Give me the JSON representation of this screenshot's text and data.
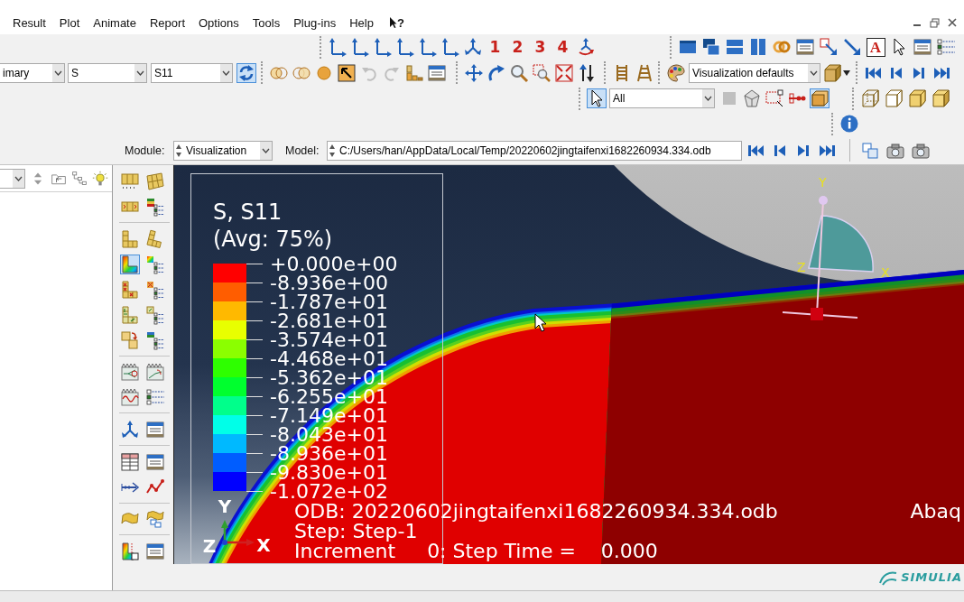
{
  "menu_bar": {
    "items": [
      "Result",
      "Plot",
      "Animate",
      "Report",
      "Options",
      "Tools",
      "Plug-ins",
      "Help"
    ],
    "context_help": "?"
  },
  "toolbar_row_1": {
    "view_tools": [
      {
        "kind": "axes",
        "pressed": false
      },
      {
        "kind": "axes",
        "pressed": false
      },
      {
        "kind": "axes",
        "pressed": false
      },
      {
        "kind": "axes",
        "pressed": false
      },
      {
        "kind": "axes",
        "pressed": false
      },
      {
        "kind": "axes",
        "pressed": false
      },
      {
        "kind": "triad",
        "pressed": false
      },
      {
        "kind": "label",
        "label": "1",
        "pressed": false
      },
      {
        "kind": "label",
        "label": "2",
        "pressed": false
      },
      {
        "kind": "label",
        "label": "3",
        "pressed": false
      },
      {
        "kind": "label",
        "label": "4",
        "pressed": false
      },
      {
        "kind": "spin",
        "pressed": false
      }
    ],
    "window_tools": [
      {
        "kind": "viewport",
        "pressed": false
      },
      {
        "kind": "cascade",
        "pressed": false
      },
      {
        "kind": "tilehor",
        "pressed": false
      },
      {
        "kind": "tilever",
        "pressed": false
      },
      {
        "kind": "link",
        "pressed": false
      },
      {
        "kind": "table",
        "pressed": false
      },
      {
        "kind": "annotate",
        "pressed": false
      },
      {
        "kind": "arrow",
        "pressed": false
      },
      {
        "kind": "boxlabel",
        "label": "A",
        "pressed": false
      },
      {
        "kind": "cursor",
        "pressed": false
      },
      {
        "kind": "table",
        "pressed": false
      },
      {
        "kind": "list",
        "pressed": false
      }
    ]
  },
  "toolbar_row_2": {
    "fields": [
      {
        "value": "imary"
      },
      {
        "value": "S"
      },
      {
        "value": "S11"
      }
    ],
    "sync_tools": [
      {
        "kind": "sync",
        "pressed": true
      }
    ],
    "plot_tools": [
      {
        "kind": "circles",
        "pressed": false,
        "disabled": false
      },
      {
        "kind": "rings",
        "pressed": false,
        "disabled": false
      },
      {
        "kind": "dot",
        "pressed": false,
        "disabled": false
      },
      {
        "kind": "probe",
        "pressed": false,
        "disabled": false
      },
      {
        "kind": "undo",
        "pressed": false,
        "disabled": true
      },
      {
        "kind": "redo",
        "pressed": false,
        "disabled": true
      },
      {
        "kind": "blocks",
        "pressed": false,
        "disabled": false
      },
      {
        "kind": "table",
        "pressed": false,
        "disabled": false
      }
    ],
    "view_tools": [
      {
        "kind": "pan",
        "pressed": false
      },
      {
        "kind": "rotate",
        "pressed": false
      },
      {
        "kind": "zoom",
        "pressed": false
      },
      {
        "kind": "boxzoom",
        "pressed": false
      },
      {
        "kind": "fit",
        "pressed": false
      },
      {
        "kind": "flip",
        "pressed": false
      }
    ],
    "ladder_tools": [
      {
        "kind": "ladder",
        "pressed": false
      },
      {
        "kind": "trapezoid",
        "pressed": false
      }
    ],
    "palette_tools": [
      {
        "kind": "palette",
        "pressed": false
      }
    ],
    "style_field": {
      "value": "Visualization defaults"
    },
    "render_tools": [
      {
        "kind": "cube",
        "pressed": false
      }
    ],
    "frame_tools": [
      {
        "kind": "first",
        "pressed": false
      },
      {
        "kind": "prev",
        "pressed": false
      },
      {
        "kind": "next",
        "pressed": false
      },
      {
        "kind": "last",
        "pressed": false
      }
    ]
  },
  "toolbar_row_3": {
    "pick_tools": [
      {
        "kind": "cursor",
        "pressed": true
      }
    ],
    "pick_field": {
      "value": "All"
    },
    "filter_tools": [
      {
        "kind": "square",
        "pressed": false,
        "disabled": true
      },
      {
        "kind": "poly",
        "pressed": false,
        "disabled": false
      },
      {
        "kind": "selectbox",
        "pressed": false,
        "disabled": false
      },
      {
        "kind": "dots",
        "pressed": false,
        "disabled": false
      },
      {
        "kind": "box",
        "pressed": true,
        "disabled": false
      }
    ],
    "style_tools": [
      {
        "kind": "wire",
        "pressed": false
      },
      {
        "kind": "hidden",
        "pressed": false
      },
      {
        "kind": "filled",
        "pressed": false
      },
      {
        "kind": "shaded",
        "pressed": false
      }
    ]
  },
  "toolbar_row_4": {
    "info_tools": [
      {
        "kind": "info",
        "pressed": false
      }
    ]
  },
  "context_bar": {
    "module_label": "Module:",
    "module_field": {
      "value": "Visualization"
    },
    "model_label": "Model:",
    "model_field": {
      "value": "C:/Users/han/AppData/Local/Temp/20220602jingtaifenxi1682260934.334.odb"
    },
    "frame_tools": [
      {
        "kind": "first",
        "pressed": false
      },
      {
        "kind": "prev",
        "pressed": false
      },
      {
        "kind": "next",
        "pressed": false
      },
      {
        "kind": "last",
        "pressed": false
      }
    ],
    "capture_tools": [
      {
        "kind": "frames",
        "pressed": false
      },
      {
        "kind": "camera",
        "pressed": false
      },
      {
        "kind": "camera",
        "pressed": false
      }
    ]
  },
  "tree_panel": {
    "tools": [
      {
        "kind": "spinarrows",
        "pressed": false
      },
      {
        "kind": "folderup",
        "pressed": false
      },
      {
        "kind": "tree",
        "pressed": false
      },
      {
        "kind": "bulb",
        "pressed": false
      }
    ]
  },
  "tool_column": {
    "groups": [
      [
        {
          "kind": "numgrid",
          "pressed": false
        },
        {
          "kind": "numskew",
          "pressed": false
        },
        {
          "kind": "strip",
          "pressed": false
        },
        {
          "kind": "layers",
          "pressed": false
        }
      ],
      [
        {
          "kind": "lgrid",
          "pressed": false
        },
        {
          "kind": "lskew",
          "pressed": false
        },
        {
          "kind": "contour",
          "pressed": true
        },
        {
          "kind": "swatchlist",
          "pressed": false
        },
        {
          "kind": "symbol",
          "pressed": false
        },
        {
          "kind": "symlist",
          "pressed": false
        },
        {
          "kind": "orient",
          "pressed": false
        },
        {
          "kind": "orientlist",
          "pressed": false
        },
        {
          "kind": "superimpose",
          "pressed": false
        },
        {
          "kind": "superlist",
          "pressed": false
        }
      ],
      [
        {
          "kind": "animscale",
          "pressed": false
        },
        {
          "kind": "animtime",
          "pressed": false
        },
        {
          "kind": "animharm",
          "pressed": false
        },
        {
          "kind": "list",
          "pressed": false
        }
      ],
      [
        {
          "kind": "triad",
          "pressed": false
        },
        {
          "kind": "table",
          "pressed": false
        }
      ],
      [
        {
          "kind": "xytable",
          "pressed": false
        },
        {
          "kind": "table",
          "pressed": false
        },
        {
          "kind": "path",
          "pressed": false
        },
        {
          "kind": "chart",
          "pressed": false
        }
      ],
      [
        {
          "kind": "warp",
          "pressed": false
        },
        {
          "kind": "warplink",
          "pressed": false
        }
      ],
      [
        {
          "kind": "probel",
          "pressed": false
        },
        {
          "kind": "table",
          "pressed": false
        }
      ]
    ]
  },
  "viewport": {
    "legend": {
      "title": "S, S11",
      "subtitle": "(Avg: 75%)",
      "bands": [
        {
          "color": "#ff0000"
        },
        {
          "color": "#ff5d00"
        },
        {
          "color": "#ffb900"
        },
        {
          "color": "#e8ff00"
        },
        {
          "color": "#8bff00"
        },
        {
          "color": "#2eff00"
        },
        {
          "color": "#00ff2e"
        },
        {
          "color": "#00ff8b"
        },
        {
          "color": "#00ffe8"
        },
        {
          "color": "#00b9ff"
        },
        {
          "color": "#005dff"
        },
        {
          "color": "#0000ff"
        }
      ],
      "labels": [
        "+0.000e+00",
        "-8.936e+00",
        "-1.787e+01",
        "-2.681e+01",
        "-3.574e+01",
        "-4.468e+01",
        "-5.362e+01",
        "-6.255e+01",
        "-7.149e+01",
        "-8.043e+01",
        "-8.936e+01",
        "-9.830e+01",
        "-1.072e+02"
      ]
    },
    "view_triad": {
      "y": "Y",
      "z": "Z",
      "x": "X"
    },
    "csys_glyph": {
      "y": "Y",
      "z": "Z",
      "x": "X"
    },
    "state_block": {
      "odb": "ODB: 20220602jingtaifenxi1682260934.334.odb",
      "solver": "Abaq",
      "step": "Step: Step-1",
      "increment": "Increment     0: Step Time =    0.000"
    }
  },
  "brand": {
    "label": "SIMULIA"
  }
}
